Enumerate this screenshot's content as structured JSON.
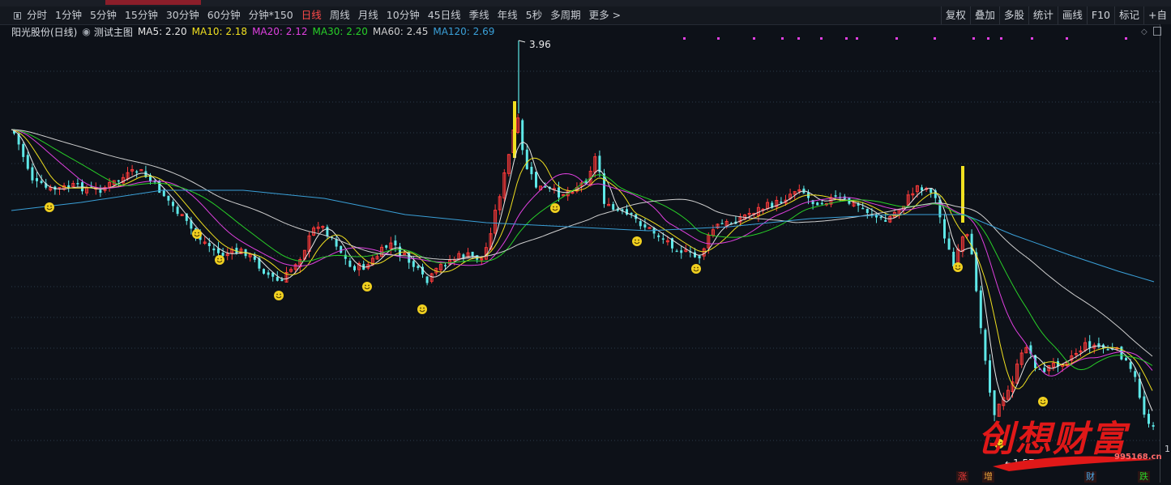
{
  "toolbar": {
    "periods": [
      {
        "label": "分时",
        "active": false
      },
      {
        "label": "1分钟",
        "active": false
      },
      {
        "label": "5分钟",
        "active": false
      },
      {
        "label": "15分钟",
        "active": false
      },
      {
        "label": "30分钟",
        "active": false
      },
      {
        "label": "60分钟",
        "active": false
      },
      {
        "label": "分钟*150",
        "active": false
      },
      {
        "label": "日线",
        "active": true
      },
      {
        "label": "周线",
        "active": false
      },
      {
        "label": "月线",
        "active": false
      },
      {
        "label": "10分钟",
        "active": false
      },
      {
        "label": "45日线",
        "active": false
      },
      {
        "label": "季线",
        "active": false
      },
      {
        "label": "年线",
        "active": false
      },
      {
        "label": "5秒",
        "active": false
      },
      {
        "label": "多周期",
        "active": false
      },
      {
        "label": "更多 >",
        "active": false
      }
    ],
    "right_buttons": [
      "复权",
      "叠加",
      "多股",
      "统计",
      "画线",
      "F10",
      "标记",
      "+自"
    ]
  },
  "infobar": {
    "stock_name": "阳光股份(日线)",
    "indicator_name": "测试主图",
    "ma5": "MA5: 2.20",
    "ma10": "MA10: 2.18",
    "ma20": "MA20: 2.12",
    "ma30": "MA30: 2.20",
    "ma60": "MA60: 2.45",
    "ma120": "MA120: 2.69"
  },
  "annotations": {
    "high_label": "3.96",
    "low_label": "1.57",
    "axis_value": "1"
  },
  "badges": [
    {
      "text": "涨",
      "color": "#e83a3a"
    },
    {
      "text": "增",
      "color": "#e8a23a"
    },
    {
      "text": "财",
      "color": "#4aa8e8"
    },
    {
      "text": "跌",
      "color": "#28d028"
    }
  ],
  "watermark": {
    "text": "创想财富",
    "url": "995168.cn"
  },
  "chart_data": {
    "type": "candlestick",
    "high": 3.96,
    "low": 1.57,
    "ma_values": {
      "MA5": 2.2,
      "MA10": 2.18,
      "MA20": 2.12,
      "MA30": 2.2,
      "MA60": 2.45,
      "MA120": 2.69
    },
    "colors": {
      "up": "#ff3a3a",
      "down": "#5ee8e8",
      "signal": "#f0e020",
      "ma5": "#e6e6e6",
      "ma10": "#f0e020",
      "ma20": "#e040e0",
      "ma30": "#28d028",
      "ma60": "#cfcfcf",
      "ma120": "#3aa0d8",
      "grid": "#2a3a4a",
      "marker": "#e040e0"
    }
  }
}
